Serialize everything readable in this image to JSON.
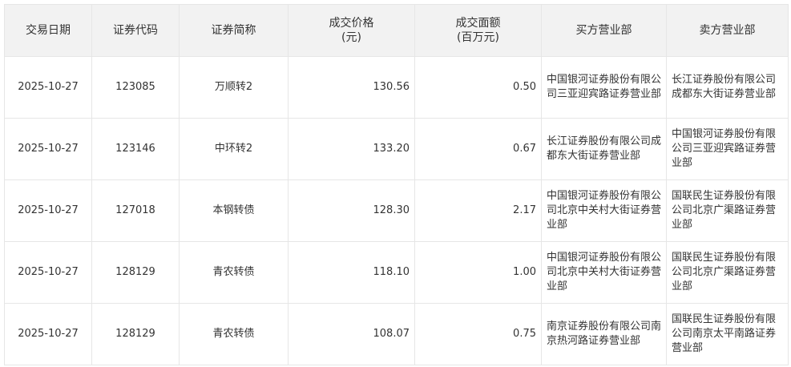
{
  "table": {
    "headers": [
      {
        "line1": "交易日期",
        "line2": ""
      },
      {
        "line1": "证券代码",
        "line2": ""
      },
      {
        "line1": "证券简称",
        "line2": ""
      },
      {
        "line1": "成交价格",
        "line2": "(元)"
      },
      {
        "line1": "成交面额",
        "line2": "(百万元)"
      },
      {
        "line1": "买方营业部",
        "line2": ""
      },
      {
        "line1": "卖方营业部",
        "line2": ""
      }
    ],
    "rows": [
      {
        "date": "2025-10-27",
        "code": "123085",
        "name": "万顺转2",
        "price": "130.56",
        "amount": "0.50",
        "buyer": "中国银河证券股份有限公司三亚迎宾路证券营业部",
        "seller": "长江证券股份有限公司成都东大街证券营业部"
      },
      {
        "date": "2025-10-27",
        "code": "123146",
        "name": "中环转2",
        "price": "133.20",
        "amount": "0.67",
        "buyer": "长江证券股份有限公司成都东大街证券营业部",
        "seller": "中国银河证券股份有限公司三亚迎宾路证券营业部"
      },
      {
        "date": "2025-10-27",
        "code": "127018",
        "name": "本钢转债",
        "price": "128.30",
        "amount": "2.17",
        "buyer": "中国银河证券股份有限公司北京中关村大街证券营业部",
        "seller": "国联民生证券股份有限公司北京广渠路证券营业部"
      },
      {
        "date": "2025-10-27",
        "code": "128129",
        "name": "青农转债",
        "price": "118.10",
        "amount": "1.00",
        "buyer": "中国银河证券股份有限公司北京中关村大街证券营业部",
        "seller": "国联民生证券股份有限公司北京广渠路证券营业部"
      },
      {
        "date": "2025-10-27",
        "code": "128129",
        "name": "青农转债",
        "price": "108.07",
        "amount": "0.75",
        "buyer": "南京证券股份有限公司南京热河路证券营业部",
        "seller": "国联民生证券股份有限公司南京太平南路证券营业部"
      }
    ]
  }
}
